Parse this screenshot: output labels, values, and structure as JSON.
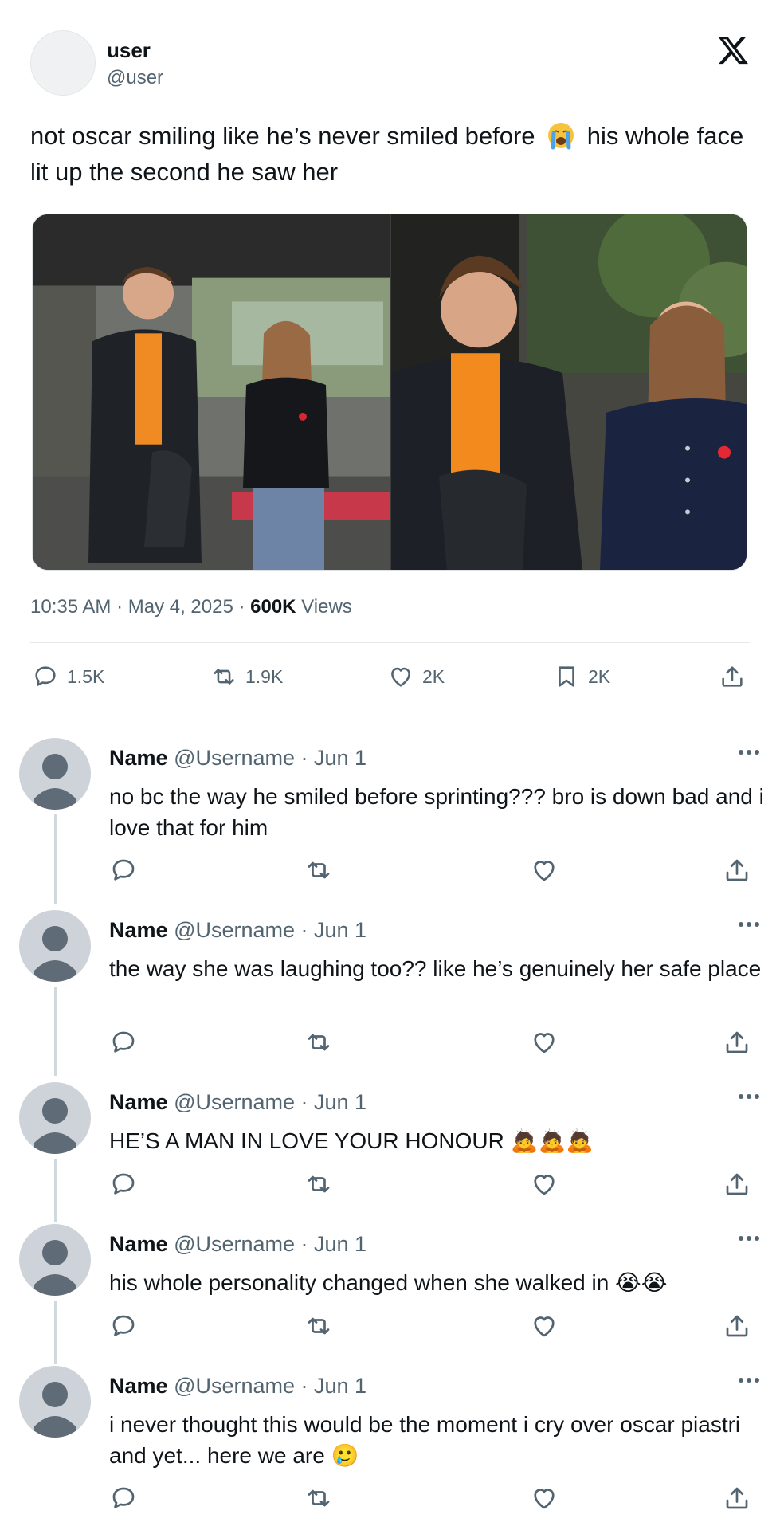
{
  "post": {
    "author_name": "user",
    "author_handle": "@user",
    "text_before": "not oscar smiling like he’s never smiled before",
    "text_emoji": "😭",
    "text_after": " his whole face lit up the second he saw her",
    "time": "10:35 AM · May 4, 2025 · ",
    "views_count": "600K",
    "views_label": " Views",
    "stats": {
      "replies": "1.5K",
      "reposts": "1.9K",
      "likes": "2K",
      "bookmarks": "2K"
    }
  },
  "replies": [
    {
      "name": "Name",
      "handle": "@Username · Jun 1",
      "text": "no bc the way he smiled before sprinting??? bro is down bad and i love that for him"
    },
    {
      "name": "Name",
      "handle": "@Username · Jun 1",
      "text": "the way she was laughing too?? like he’s genuinely her safe place"
    },
    {
      "name": "Name",
      "handle": "@Username · Jun 1",
      "text": "HE’S A MAN IN LOVE YOUR HONOUR 🙇🙇🙇"
    },
    {
      "name": "Name",
      "handle": "@Username · Jun 1",
      "text": "his whole personality changed when she walked in 😭😭"
    },
    {
      "name": "Name",
      "handle": "@Username · Jun 1",
      "text": "i never thought this would be the moment i cry over oscar piastri and yet... here we are 🥲"
    }
  ],
  "icons": {
    "brand": "x-logo-icon",
    "reply": "reply-icon",
    "repost": "repost-icon",
    "like": "heart-icon",
    "bookmark": "bookmark-icon",
    "share": "share-icon",
    "more": "more-icon"
  },
  "colors": {
    "text": "#0f1419",
    "secondary": "#536471",
    "divider": "#e6e9eb",
    "thread_line": "#cfd9de"
  }
}
